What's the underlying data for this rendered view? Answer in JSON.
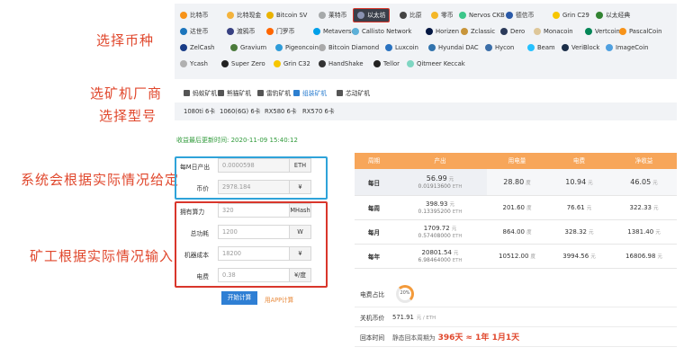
{
  "annotations": {
    "select_coin": "选择币种",
    "select_miner_maker": "选矿机厂商",
    "select_model": "选择型号",
    "system_given": "系统会根据实际情况给定",
    "miner_input": "矿工根据实际情况输入"
  },
  "coins": [
    {
      "name": "比特币",
      "color": "#f7931a"
    },
    {
      "name": "比特现金",
      "color": "#f4b33c"
    },
    {
      "name": "Bitcoin SV",
      "color": "#eab300"
    },
    {
      "name": "莱特币",
      "color": "#a6a9aa"
    },
    {
      "name": "以太坊",
      "color": "#8a92b2",
      "selected": true
    },
    {
      "name": "比原",
      "color": "#444444"
    },
    {
      "name": "零币",
      "color": "#f4b728"
    },
    {
      "name": "Nervos CKB",
      "color": "#3cc68a"
    },
    {
      "name": "德信币",
      "color": "#2b5aa8"
    },
    {
      "name": "Grin C29",
      "color": "#f7c600"
    },
    {
      "name": "以太经典",
      "color": "#328332"
    },
    {
      "name": "达世币",
      "color": "#1c75bc"
    },
    {
      "name": "渡鸦币",
      "color": "#384182"
    },
    {
      "name": "门罗币",
      "color": "#ff6600"
    },
    {
      "name": "Metaverse",
      "color": "#00a0e9"
    },
    {
      "name": "Callisto Network",
      "color": "#5db0d8"
    },
    {
      "name": "Horizen",
      "color": "#041742"
    },
    {
      "name": "Zclassic",
      "color": "#c8953a"
    },
    {
      "name": "Dero",
      "color": "#2b3a5a"
    },
    {
      "name": "Monacoin",
      "color": "#dec799"
    },
    {
      "name": "Vertcoin",
      "color": "#048657"
    },
    {
      "name": "PascalCoin",
      "color": "#f7931a"
    },
    {
      "name": "ZelCash",
      "color": "#183c87"
    },
    {
      "name": "Gravium",
      "color": "#4a7a3a"
    },
    {
      "name": "Pigeoncoin",
      "color": "#2f9cd9"
    },
    {
      "name": "Bitcoin Diamond",
      "color": "#aaaaaa"
    },
    {
      "name": "Luxcoin",
      "color": "#2a72c0"
    },
    {
      "name": "Hyundai DAC",
      "color": "#3173ad"
    },
    {
      "name": "Hycon",
      "color": "#3b6ea8"
    },
    {
      "name": "Beam",
      "color": "#25c1ff"
    },
    {
      "name": "VeriBlock",
      "color": "#1b2e48"
    },
    {
      "name": "ImageCoin",
      "color": "#4fa0e0"
    },
    {
      "name": "Ycash",
      "color": "#b0b0b0"
    },
    {
      "name": "Super Zero",
      "color": "#222222"
    },
    {
      "name": "Grin C32",
      "color": "#f7c600"
    },
    {
      "name": "HandShake",
      "color": "#333333"
    },
    {
      "name": "Tellor",
      "color": "#222222"
    },
    {
      "name": "Qitmeer Keccak",
      "color": "#7fd6c2"
    }
  ],
  "miner_makers": [
    {
      "name": "蚂蚁矿机",
      "active": false
    },
    {
      "name": "熊猫矿机",
      "active": false
    },
    {
      "name": "雷豹矿机",
      "active": false
    },
    {
      "name": "组装矿机",
      "active": true
    },
    {
      "name": "芯动矿机",
      "active": false
    }
  ],
  "models": [
    "1080ti 6卡",
    "1060(6G) 6卡",
    "RX580 6卡",
    "RX570 6卡"
  ],
  "update_time": "收益最后更新时间: 2020-11-09 15:40:12",
  "form": {
    "output_per_m": {
      "label": "每M日产出",
      "value": "0.0000598",
      "unit": "ETH"
    },
    "coin_price": {
      "label": "币价",
      "value": "2978.184",
      "unit": "¥"
    },
    "hashrate": {
      "label": "拥有算力",
      "value": "320",
      "unit": "MHash"
    },
    "power": {
      "label": "总功耗",
      "value": "1200",
      "unit": "W"
    },
    "miner_cost": {
      "label": "机器成本",
      "value": "18200",
      "unit": "¥"
    },
    "electricity": {
      "label": "电费",
      "value": "0.38",
      "unit": "¥/度"
    }
  },
  "calc_button": "开始计算",
  "app_link": "用APP计算",
  "table": {
    "headers": [
      "周期",
      "产出",
      "用电量",
      "电费",
      "净收益"
    ],
    "rows": [
      {
        "period": "每日",
        "cny": "56.99",
        "cny_unit": "元",
        "eth": "0.01913600",
        "eth_unit": "ETH",
        "kwh": "28.80",
        "kwh_unit": "度",
        "fee": "10.94",
        "fee_unit": "元",
        "net": "46.05",
        "net_unit": "元"
      },
      {
        "period": "每周",
        "cny": "398.93",
        "cny_unit": "元",
        "eth": "0.13395200",
        "eth_unit": "ETH",
        "kwh": "201.60",
        "kwh_unit": "度",
        "fee": "76.61",
        "fee_unit": "元",
        "net": "322.33",
        "net_unit": "元"
      },
      {
        "period": "每月",
        "cny": "1709.72",
        "cny_unit": "元",
        "eth": "0.57408000",
        "eth_unit": "ETH",
        "kwh": "864.00",
        "kwh_unit": "度",
        "fee": "328.32",
        "fee_unit": "元",
        "net": "1381.40",
        "net_unit": "元"
      },
      {
        "period": "每年",
        "cny": "20801.54",
        "cny_unit": "元",
        "eth": "6.98464000",
        "eth_unit": "ETH",
        "kwh": "10512.00",
        "kwh_unit": "度",
        "fee": "3994.56",
        "fee_unit": "元",
        "net": "16806.98",
        "net_unit": "元"
      }
    ]
  },
  "extra": {
    "elec_ratio_label": "电费占比",
    "elec_ratio_value": "20%",
    "elec_ratio_fraction": 0.2,
    "shutdown_label": "关机币价",
    "shutdown_value": "571.91",
    "shutdown_unit": "元 / ETH",
    "payback_label": "回本时间",
    "payback_prefix": "静态回本周期为",
    "payback_value": "396天 ≈ 1年 1月1天"
  }
}
